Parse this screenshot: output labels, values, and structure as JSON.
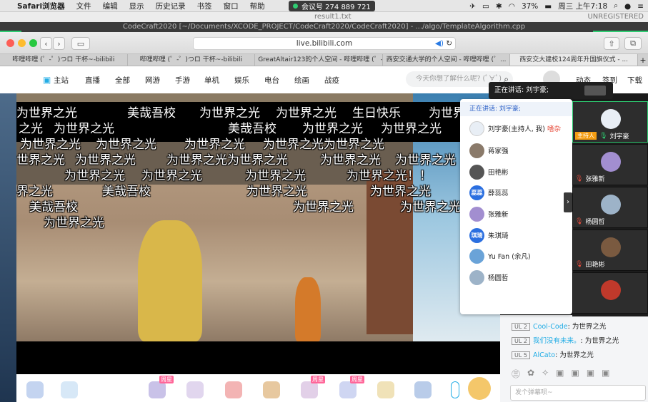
{
  "menubar": {
    "app": "Safari浏览器",
    "items": [
      "文件",
      "编辑",
      "显示",
      "历史记录",
      "书签",
      "窗口",
      "帮助"
    ],
    "meeting_id": "会议号 274 889 721",
    "battery": "37%",
    "clock": "周三 上午7:18"
  },
  "editor": {
    "file": "result1.txt",
    "unregistered": "UNREGISTERED",
    "xcode_path": "CodeCraft2020 [~/Documents/XCODE_PROJECT/CodeCraft2020/CodeCraft2020] - .../algo/TemplateAlgorithm.cpp"
  },
  "safari": {
    "url": "live.bilibili.com",
    "tabs": [
      "哔哩哔哩 (゜-゜)つロ 干杯~-bilibili",
      "哔哩哔哩 (゜-゜)つロ 干杯~-bilibili",
      "GreatAltair123的个人空间 - 哔哩哔哩 (゜-...",
      "西安交通大学的个人空间 - 哔哩哔哩 (゜...",
      "西安交大建校124周年升国旗仪式 - ..."
    ]
  },
  "bnav": {
    "home": "主站",
    "items": [
      "直播",
      "全部",
      "网游",
      "手游",
      "单机",
      "娱乐",
      "电台",
      "绘画",
      "战疫"
    ],
    "search_placeholder": "今天你想了解什么呢? (ﾟ∀ﾟ)",
    "right_items": [
      "动态",
      "签到",
      "下载"
    ]
  },
  "danmaku": [
    "为世界之光",
    "美哉吾校",
    "为世界之光",
    "为世界之光",
    "生日快乐",
    "为世界",
    "之光",
    "为世界之光",
    "美哉吾校",
    "为世界之光",
    "为世界之光",
    "为世界之光",
    "为世界之光",
    "为世界之光",
    "为世界之光为世界之光",
    "世界之光",
    "为世界之光",
    "为世界之光为世界之光",
    "为世界之光",
    "为世界之光",
    "为世界之光",
    "为世界之光",
    "为世界之光",
    "为世界之光！！",
    "界之光",
    "美哉吾校",
    "为世界之光",
    "为世界之光",
    "美哉吾校",
    "为世界之光",
    "为世界之光",
    "为世界之光"
  ],
  "meeting": {
    "speaking_top": "正在讲话: 刘宇豪;",
    "speaking_list": "正在讲话: 刘宇豪;",
    "host_self": "刘宇豪(主持人, 我)",
    "mute_label": "嗜杂",
    "participants": [
      {
        "name": "蒋家强",
        "avatar": "",
        "color": "#8a7a6a"
      },
      {
        "name": "田艳彬",
        "avatar": "",
        "color": "#555"
      },
      {
        "name": "薛蕊蕊",
        "avatar": "蕊蕊",
        "color": "#2b6fe0"
      },
      {
        "name": "张雅新",
        "avatar": "",
        "color": "#a28ed0"
      },
      {
        "name": "朱琪琦",
        "avatar": "琪琦",
        "color": "#2b6fe0"
      },
      {
        "name": "Yu Fan (余凡)",
        "avatar": "",
        "color": "#6aa3d8"
      },
      {
        "name": "杨圆哲",
        "avatar": "",
        "color": "#9db3c8"
      }
    ],
    "host_tag": "主持人",
    "tiles": [
      {
        "name": "刘宇豪",
        "color": "#e8eef5"
      },
      {
        "name": "张雅新",
        "color": "#a28ed0"
      },
      {
        "name": "杨圆哲",
        "color": "#9db3c8"
      },
      {
        "name": "田艳彬",
        "color": "#7a5a40"
      },
      {
        "name": "",
        "color": "#c0392b"
      }
    ]
  },
  "chat": {
    "messages": [
      {
        "level": "UL 2",
        "user": "Cool-Code",
        "text": ": 为世界之光"
      },
      {
        "level": "UL 2",
        "user": "我们没有未来。",
        "text": ": 为世界之光"
      },
      {
        "level": "UL 5",
        "user": "AlCato",
        "text": ": 为世界之光"
      }
    ],
    "input_placeholder": "发个弹幕呗~"
  },
  "gifts": {
    "tag": "周星"
  }
}
